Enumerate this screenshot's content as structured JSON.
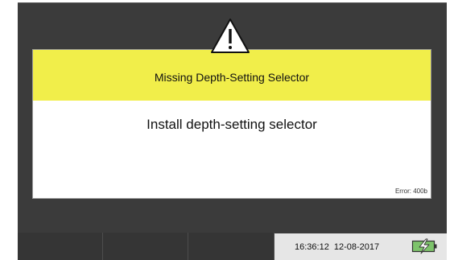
{
  "dialog": {
    "title": "Missing Depth-Setting Selector",
    "message": "Install depth-setting selector",
    "error_code": "Error: 400b",
    "icon": "warning-triangle-icon"
  },
  "status_bar": {
    "time": "16:36:12",
    "date": "12-08-2017",
    "battery_icon": "battery-charging-icon"
  },
  "softkeys": [
    "",
    "",
    ""
  ],
  "colors": {
    "screen_background": "#3b3b3b",
    "dialog_header": "#f1ee4a",
    "battery_fill": "#7dc36b"
  }
}
